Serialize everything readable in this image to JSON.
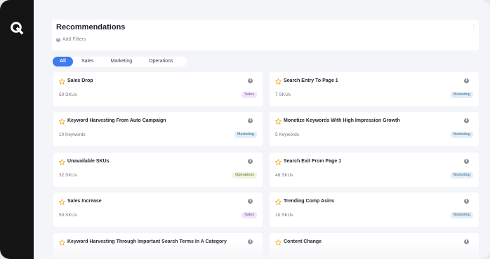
{
  "app": {
    "logo_icon": "q-logo-icon"
  },
  "header": {
    "title": "Recommendations",
    "add_filters_label": "Add Filters"
  },
  "tabs": [
    {
      "label": "All",
      "active": true
    },
    {
      "label": "Sales",
      "active": false
    },
    {
      "label": "Marketing",
      "active": false
    },
    {
      "label": "Operations",
      "active": false
    }
  ],
  "cards": [
    {
      "title": "Sales Drop",
      "count": "50 SKUs",
      "tag": "Sales"
    },
    {
      "title": "Search Entry To Page 1",
      "count": "7 SKUs",
      "tag": "Marketing"
    },
    {
      "title": "Keyword Harvesting From Auto Campaign",
      "count": "10 Keywords",
      "tag": "Marketing"
    },
    {
      "title": "Monetize Keywords With High Impression Growth",
      "count": "5 Keywords",
      "tag": "Marketing"
    },
    {
      "title": "Unavailable SKUs",
      "count": "32 SKUs",
      "tag": "Operations"
    },
    {
      "title": "Search Exit From Page 1",
      "count": "48 SKUs",
      "tag": "Marketing"
    },
    {
      "title": "Sales Increase",
      "count": "50 SKUs",
      "tag": "Sales"
    },
    {
      "title": "Trending Comp Asins",
      "count": "10 SKUs",
      "tag": "Marketing"
    },
    {
      "title": "Keyword Harvesting Through Important Search Terms In A Category",
      "count": "",
      "tag": ""
    },
    {
      "title": "Content Change",
      "count": "",
      "tag": ""
    }
  ],
  "colors": {
    "accent": "#3d7cf0",
    "rail": "#141414",
    "star": "#f0a81c"
  }
}
